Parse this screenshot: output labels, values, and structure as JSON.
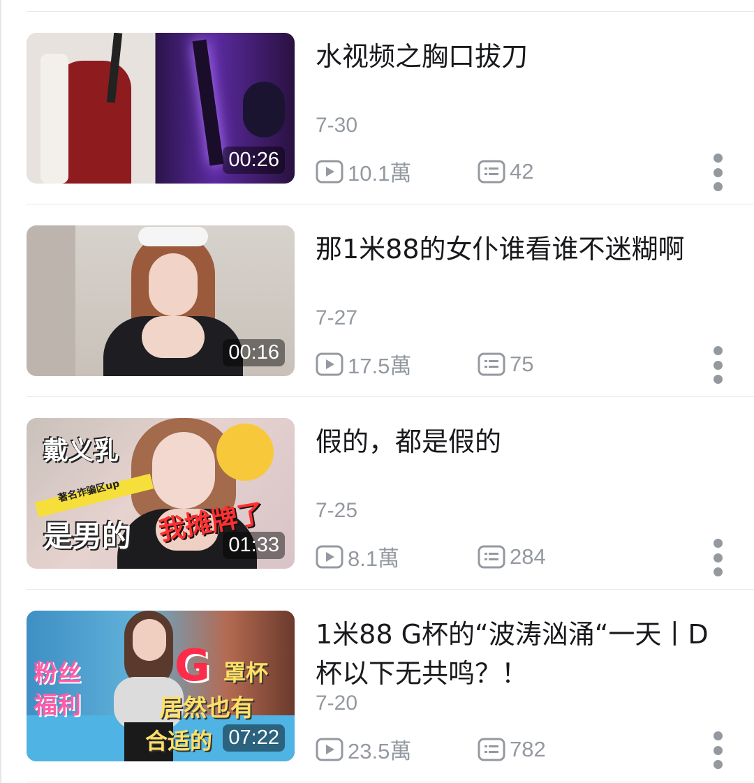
{
  "videos": [
    {
      "title": "水视频之胸口拔刀",
      "date": "7-30",
      "views": "10.1萬",
      "comments": "42",
      "duration": "00:26",
      "thumb_text": []
    },
    {
      "title": "那1米88的女仆谁看谁不迷糊啊",
      "date": "7-27",
      "views": "17.5萬",
      "comments": "75",
      "duration": "00:16",
      "thumb_text": []
    },
    {
      "title": "假的，都是假的",
      "date": "7-25",
      "views": "8.1萬",
      "comments": "284",
      "duration": "01:33",
      "thumb_text": [
        "戴义乳",
        "著名诈骗区up",
        "是男的",
        "我摊牌了"
      ]
    },
    {
      "title": "1米88 G杯的“波涛汹涌“一天丨D杯以下无共鸣？！",
      "date": "7-20",
      "views": "23.5萬",
      "comments": "782",
      "duration": "07:22",
      "thumb_text": [
        "粉丝",
        "福利",
        "G",
        "罩杯",
        "居然也有",
        "合适的"
      ]
    }
  ],
  "icons": {
    "views": "play-icon",
    "comments": "comment-icon",
    "more": "more-vertical-icon"
  },
  "colors": {
    "meta_text": "#9499a0",
    "title_text": "#18191c",
    "divider": "#e9e9eb"
  }
}
